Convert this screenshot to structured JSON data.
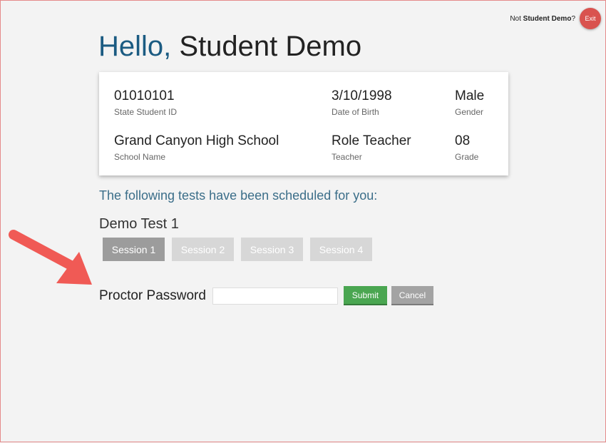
{
  "header": {
    "not_prefix": "Not",
    "user_name": "Student Demo",
    "not_suffix": "?",
    "exit_label": "Exit"
  },
  "greeting": {
    "hello": "Hello,",
    "name": "Student Demo"
  },
  "student_info": {
    "state_id": {
      "value": "01010101",
      "label": "State Student ID"
    },
    "dob": {
      "value": "3/10/1998",
      "label": "Date of Birth"
    },
    "gender": {
      "value": "Male",
      "label": "Gender"
    },
    "school": {
      "value": "Grand Canyon High School",
      "label": "School Name"
    },
    "teacher": {
      "value": "Role Teacher",
      "label": "Teacher"
    },
    "grade": {
      "value": "08",
      "label": "Grade"
    }
  },
  "tests": {
    "scheduled_text": "The following tests have been scheduled for you:",
    "test_name": "Demo Test 1",
    "sessions": [
      "Session 1",
      "Session 2",
      "Session 3",
      "Session 4"
    ],
    "active_session": "Session 1"
  },
  "proctor": {
    "label": "Proctor Password",
    "password_value": "",
    "submit_label": "Submit",
    "cancel_label": "Cancel"
  },
  "colors": {
    "hello": "#1b5b82",
    "exit_button": "#d9534f",
    "submit_button": "#4aa651",
    "cancel_button": "#a3a3a3",
    "annotation_arrow": "#f05a55"
  }
}
